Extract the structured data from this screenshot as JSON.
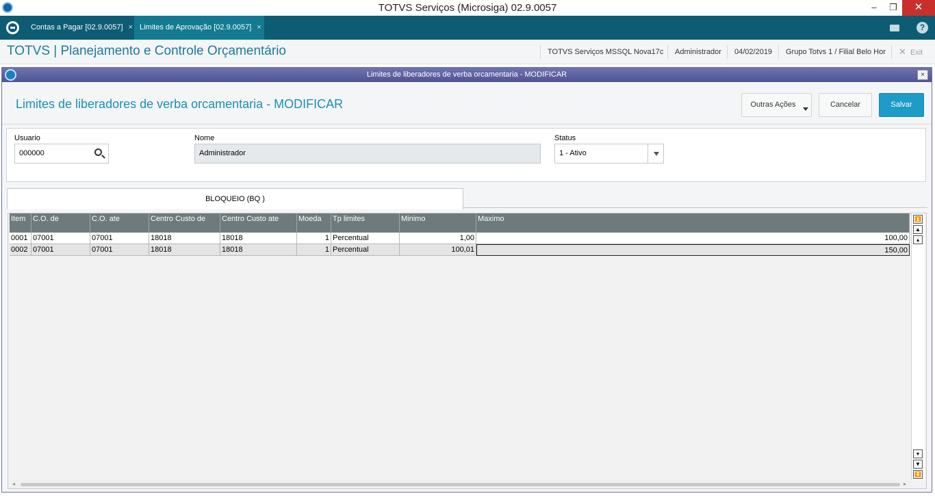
{
  "window": {
    "title": "TOTVS Serviços (Microsiga) 02.9.0057",
    "minimize": "–",
    "maximize": "❐",
    "close": "✕"
  },
  "tabs": [
    {
      "label": "Contas a Pagar [02.9.0057]",
      "close": "×"
    },
    {
      "label": "Limites de Aprovação [02.9.0057]",
      "close": "×"
    }
  ],
  "header": {
    "module_title": "TOTVS | Planejamento e Controle Orçamentário",
    "environment": "TOTVS Serviços MSSQL Nova17c",
    "user": "Administrador",
    "date": "04/02/2019",
    "branch": "Grupo Totvs 1 / Filial Belo Hor",
    "exit_label": "Exit",
    "help": "?"
  },
  "dialog": {
    "title": "Limites de liberadores de verba orcamentaria - MODIFICAR",
    "close": "×",
    "heading": "Limites de liberadores de verba orcamentaria - MODIFICAR",
    "buttons": {
      "other_actions": "Outras Ações",
      "cancel": "Cancelar",
      "save": "Salvar"
    }
  },
  "form": {
    "user_label": "Usuario",
    "user_value": "000000",
    "name_label": "Nome",
    "name_value": "Administrador",
    "status_label": "Status",
    "status_value": "1 - Ativo"
  },
  "folder_tab": "BLOQUEIO (BQ )",
  "grid": {
    "columns": [
      "Item",
      "C.O. de",
      "C.O. ate",
      "Centro Custo de",
      "Centro Custo ate",
      "Moeda",
      "Tp limites",
      "Minimo",
      "Maximo"
    ],
    "rows": [
      {
        "item": "0001",
        "co_de": "07001",
        "co_ate": "07001",
        "cc_de": "18018",
        "cc_ate": "18018",
        "moeda": "1",
        "tp_limites": "Percentual",
        "minimo": "1,00",
        "maximo": "100,00"
      },
      {
        "item": "0002",
        "co_de": "07001",
        "co_ate": "07001",
        "cc_de": "18018",
        "cc_ate": "18018",
        "moeda": "1",
        "tp_limites": "Percentual",
        "minimo": "100,01",
        "maximo": "150,00"
      }
    ]
  }
}
